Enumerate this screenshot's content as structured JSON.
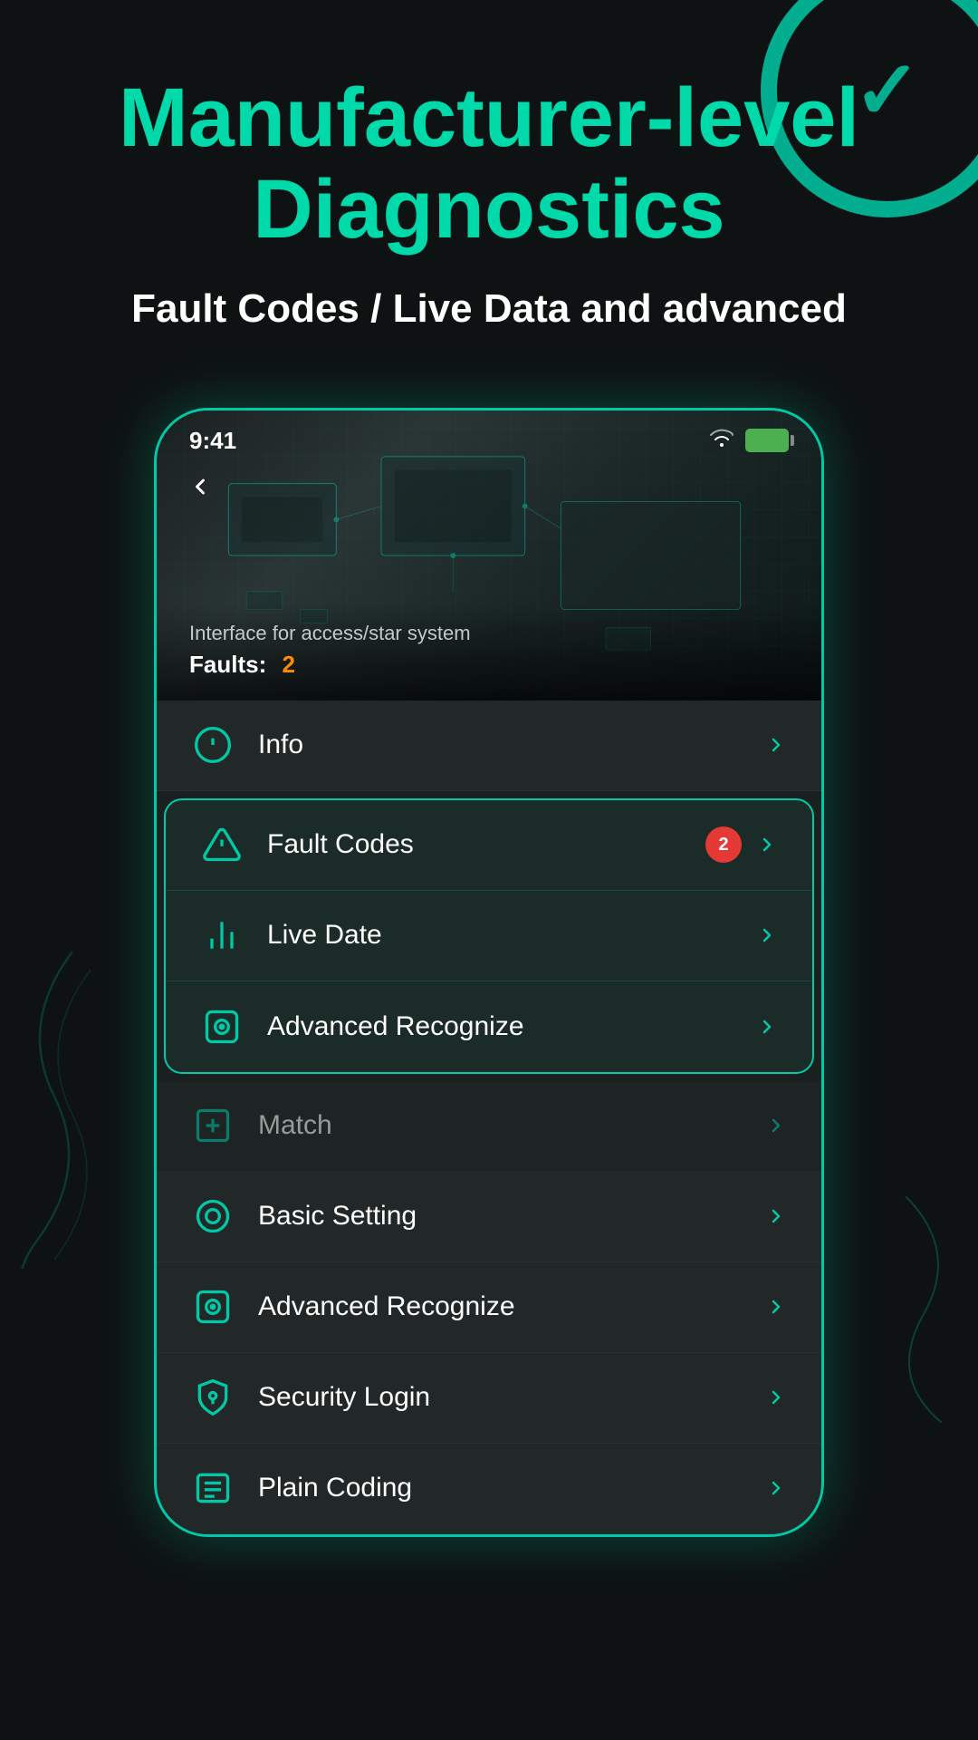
{
  "header": {
    "main_title": "Manufacturer-level Diagnostics",
    "subtitle": "Fault Codes / Live Data and advanced"
  },
  "status_bar": {
    "time": "9:41",
    "wifi_label": "wifi",
    "battery_label": "battery"
  },
  "hero": {
    "subtitle": "Interface for access/star system",
    "faults_label": "Faults:",
    "faults_count": "2"
  },
  "menu_items": {
    "info": {
      "label": "Info",
      "icon": "info-icon"
    },
    "fault_codes": {
      "label": "Fault Codes",
      "badge": "2",
      "icon": "fault-codes-icon",
      "highlighted": true
    },
    "live_date": {
      "label": "Live Date",
      "icon": "live-data-icon",
      "highlighted": true
    },
    "advanced_recognize_highlighted": {
      "label": "Advanced Recognize",
      "icon": "advanced-recognize-icon",
      "highlighted": true
    },
    "match": {
      "label": "Match",
      "icon": "match-icon"
    },
    "basic_setting": {
      "label": "Basic Setting",
      "icon": "basic-setting-icon"
    },
    "advanced_recognize": {
      "label": "Advanced Recognize",
      "icon": "advanced-recognize-icon2"
    },
    "security_login": {
      "label": "Security Login",
      "icon": "security-login-icon"
    },
    "plain_coding": {
      "label": "Plain Coding",
      "icon": "plain-coding-icon"
    }
  },
  "colors": {
    "accent": "#00c9a7",
    "badge_red": "#e53935",
    "faults_orange": "#ff8c00",
    "bg_dark": "#0e1212",
    "card_bg": "#222828"
  }
}
